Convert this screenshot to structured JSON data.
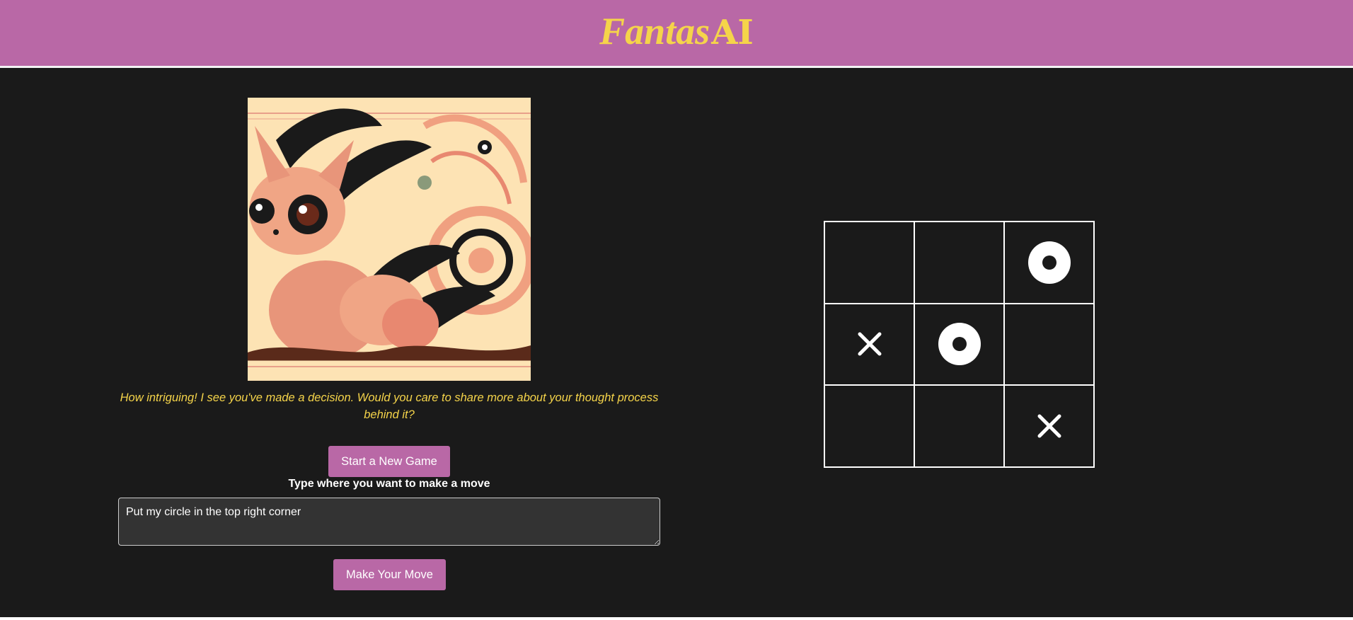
{
  "header": {
    "logo_script": "Fantas",
    "logo_ai": "AI",
    "background": "#b968a6",
    "logo_color": "#f5d44a"
  },
  "left_panel": {
    "image_icon": "fantasy-creature-illustration",
    "message": "How intriguing! I see you've made a decision. Would you care to share more about your thought process behind it?",
    "new_game_label": "Start a New Game",
    "prompt_label": "Type where you want to make a move",
    "move_input_value": "Put my circle in the top right corner",
    "make_move_label": "Make Your Move"
  },
  "board": {
    "cells": [
      "",
      "",
      "O",
      "X",
      "O",
      "",
      "",
      "",
      "X"
    ]
  },
  "colors": {
    "accent": "#b968a6",
    "message": "#f5d44a",
    "panel_bg": "#1a1a1a"
  }
}
